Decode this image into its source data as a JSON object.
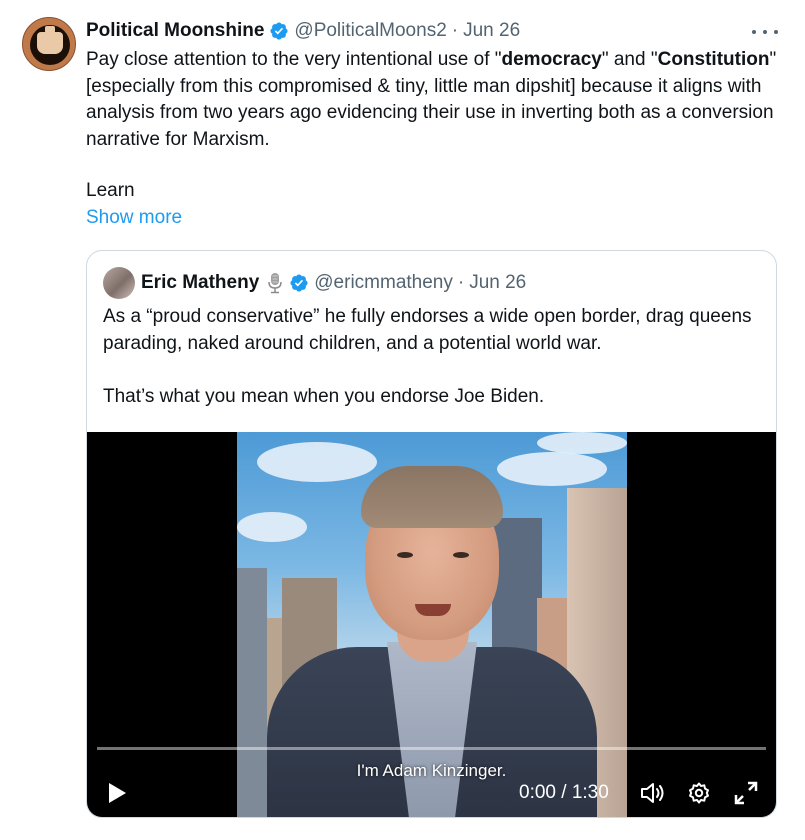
{
  "tweet": {
    "display_name": "Political Moonshine",
    "handle": "@PoliticalMoons2",
    "separator": "·",
    "date": "Jun 26",
    "text_parts": {
      "p1": "Pay close attention to the very intentional use of \"",
      "b1": "democracy",
      "p2": "\" and \"",
      "b2": "Constitution",
      "p3": "\" [especially from this compromised & tiny, little man dipshit] because it aligns with analysis from two years ago evidencing their use in inverting both as a conversion narrative for Marxism."
    },
    "truncated_text": "Learn",
    "show_more_label": "Show more"
  },
  "quote": {
    "display_name": "Eric Matheny",
    "handle": "@ericmmatheny",
    "separator": "·",
    "date": "Jun 26",
    "text_line1": "As a “proud conservative” he fully endorses a wide open border, drag queens parading, naked around children, and a potential world war.",
    "text_line2": "That’s what you mean when you endorse Joe Biden."
  },
  "video": {
    "subtitle": "I'm Adam Kinzinger.",
    "time_display": "0:00 / 1:30",
    "progress": 0
  },
  "colors": {
    "link_blue": "#1d9bf0",
    "secondary_text": "#536471",
    "border": "#cfd9de"
  }
}
